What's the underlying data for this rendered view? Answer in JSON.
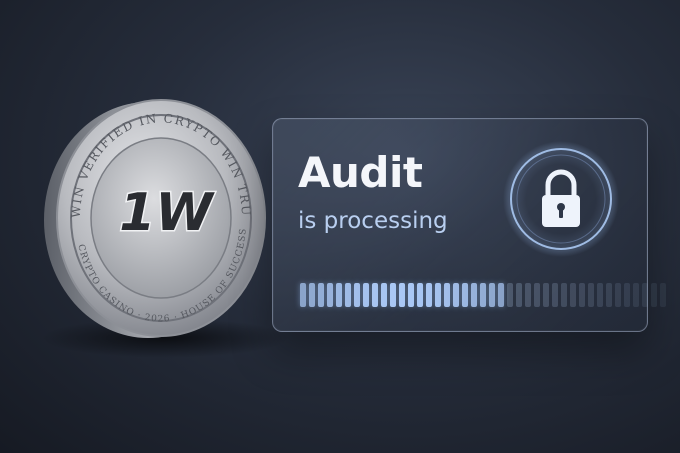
{
  "coin": {
    "logo_text": "1W",
    "rim_top_text": "WIN VERIFIED IN CRYPTO WIN TRUST",
    "rim_bottom_text": "CRYPTO CASINO · 2026 · HOUSE OF SUCCESS"
  },
  "panel": {
    "title": "Audit",
    "subtitle": "is processing"
  },
  "lock_icon": "padlock-icon",
  "progress": {
    "fraction": 0.55,
    "segments": 41
  },
  "colors": {
    "background": "#262d3b",
    "accent_blue": "#a9c8f5",
    "title_white": "#f4f6fa",
    "coin_silver": "#c3c4c8"
  }
}
